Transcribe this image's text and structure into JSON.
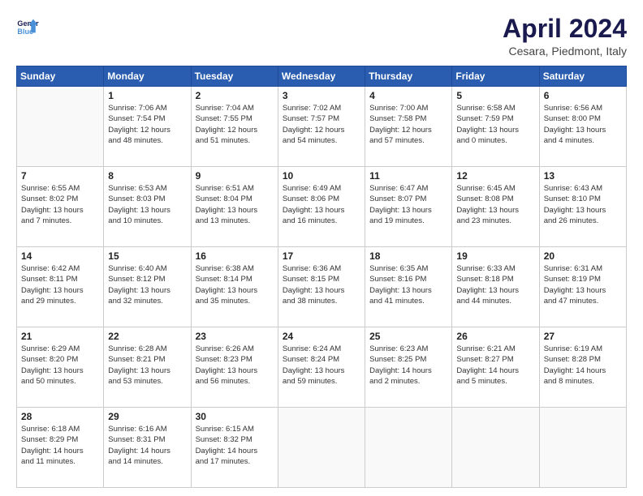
{
  "header": {
    "logo_line1": "General",
    "logo_line2": "Blue",
    "title": "April 2024",
    "location": "Cesara, Piedmont, Italy"
  },
  "weekdays": [
    "Sunday",
    "Monday",
    "Tuesday",
    "Wednesday",
    "Thursday",
    "Friday",
    "Saturday"
  ],
  "weeks": [
    [
      {
        "day": "",
        "info": ""
      },
      {
        "day": "1",
        "info": "Sunrise: 7:06 AM\nSunset: 7:54 PM\nDaylight: 12 hours\nand 48 minutes."
      },
      {
        "day": "2",
        "info": "Sunrise: 7:04 AM\nSunset: 7:55 PM\nDaylight: 12 hours\nand 51 minutes."
      },
      {
        "day": "3",
        "info": "Sunrise: 7:02 AM\nSunset: 7:57 PM\nDaylight: 12 hours\nand 54 minutes."
      },
      {
        "day": "4",
        "info": "Sunrise: 7:00 AM\nSunset: 7:58 PM\nDaylight: 12 hours\nand 57 minutes."
      },
      {
        "day": "5",
        "info": "Sunrise: 6:58 AM\nSunset: 7:59 PM\nDaylight: 13 hours\nand 0 minutes."
      },
      {
        "day": "6",
        "info": "Sunrise: 6:56 AM\nSunset: 8:00 PM\nDaylight: 13 hours\nand 4 minutes."
      }
    ],
    [
      {
        "day": "7",
        "info": "Sunrise: 6:55 AM\nSunset: 8:02 PM\nDaylight: 13 hours\nand 7 minutes."
      },
      {
        "day": "8",
        "info": "Sunrise: 6:53 AM\nSunset: 8:03 PM\nDaylight: 13 hours\nand 10 minutes."
      },
      {
        "day": "9",
        "info": "Sunrise: 6:51 AM\nSunset: 8:04 PM\nDaylight: 13 hours\nand 13 minutes."
      },
      {
        "day": "10",
        "info": "Sunrise: 6:49 AM\nSunset: 8:06 PM\nDaylight: 13 hours\nand 16 minutes."
      },
      {
        "day": "11",
        "info": "Sunrise: 6:47 AM\nSunset: 8:07 PM\nDaylight: 13 hours\nand 19 minutes."
      },
      {
        "day": "12",
        "info": "Sunrise: 6:45 AM\nSunset: 8:08 PM\nDaylight: 13 hours\nand 23 minutes."
      },
      {
        "day": "13",
        "info": "Sunrise: 6:43 AM\nSunset: 8:10 PM\nDaylight: 13 hours\nand 26 minutes."
      }
    ],
    [
      {
        "day": "14",
        "info": "Sunrise: 6:42 AM\nSunset: 8:11 PM\nDaylight: 13 hours\nand 29 minutes."
      },
      {
        "day": "15",
        "info": "Sunrise: 6:40 AM\nSunset: 8:12 PM\nDaylight: 13 hours\nand 32 minutes."
      },
      {
        "day": "16",
        "info": "Sunrise: 6:38 AM\nSunset: 8:14 PM\nDaylight: 13 hours\nand 35 minutes."
      },
      {
        "day": "17",
        "info": "Sunrise: 6:36 AM\nSunset: 8:15 PM\nDaylight: 13 hours\nand 38 minutes."
      },
      {
        "day": "18",
        "info": "Sunrise: 6:35 AM\nSunset: 8:16 PM\nDaylight: 13 hours\nand 41 minutes."
      },
      {
        "day": "19",
        "info": "Sunrise: 6:33 AM\nSunset: 8:18 PM\nDaylight: 13 hours\nand 44 minutes."
      },
      {
        "day": "20",
        "info": "Sunrise: 6:31 AM\nSunset: 8:19 PM\nDaylight: 13 hours\nand 47 minutes."
      }
    ],
    [
      {
        "day": "21",
        "info": "Sunrise: 6:29 AM\nSunset: 8:20 PM\nDaylight: 13 hours\nand 50 minutes."
      },
      {
        "day": "22",
        "info": "Sunrise: 6:28 AM\nSunset: 8:21 PM\nDaylight: 13 hours\nand 53 minutes."
      },
      {
        "day": "23",
        "info": "Sunrise: 6:26 AM\nSunset: 8:23 PM\nDaylight: 13 hours\nand 56 minutes."
      },
      {
        "day": "24",
        "info": "Sunrise: 6:24 AM\nSunset: 8:24 PM\nDaylight: 13 hours\nand 59 minutes."
      },
      {
        "day": "25",
        "info": "Sunrise: 6:23 AM\nSunset: 8:25 PM\nDaylight: 14 hours\nand 2 minutes."
      },
      {
        "day": "26",
        "info": "Sunrise: 6:21 AM\nSunset: 8:27 PM\nDaylight: 14 hours\nand 5 minutes."
      },
      {
        "day": "27",
        "info": "Sunrise: 6:19 AM\nSunset: 8:28 PM\nDaylight: 14 hours\nand 8 minutes."
      }
    ],
    [
      {
        "day": "28",
        "info": "Sunrise: 6:18 AM\nSunset: 8:29 PM\nDaylight: 14 hours\nand 11 minutes."
      },
      {
        "day": "29",
        "info": "Sunrise: 6:16 AM\nSunset: 8:31 PM\nDaylight: 14 hours\nand 14 minutes."
      },
      {
        "day": "30",
        "info": "Sunrise: 6:15 AM\nSunset: 8:32 PM\nDaylight: 14 hours\nand 17 minutes."
      },
      {
        "day": "",
        "info": ""
      },
      {
        "day": "",
        "info": ""
      },
      {
        "day": "",
        "info": ""
      },
      {
        "day": "",
        "info": ""
      }
    ]
  ]
}
